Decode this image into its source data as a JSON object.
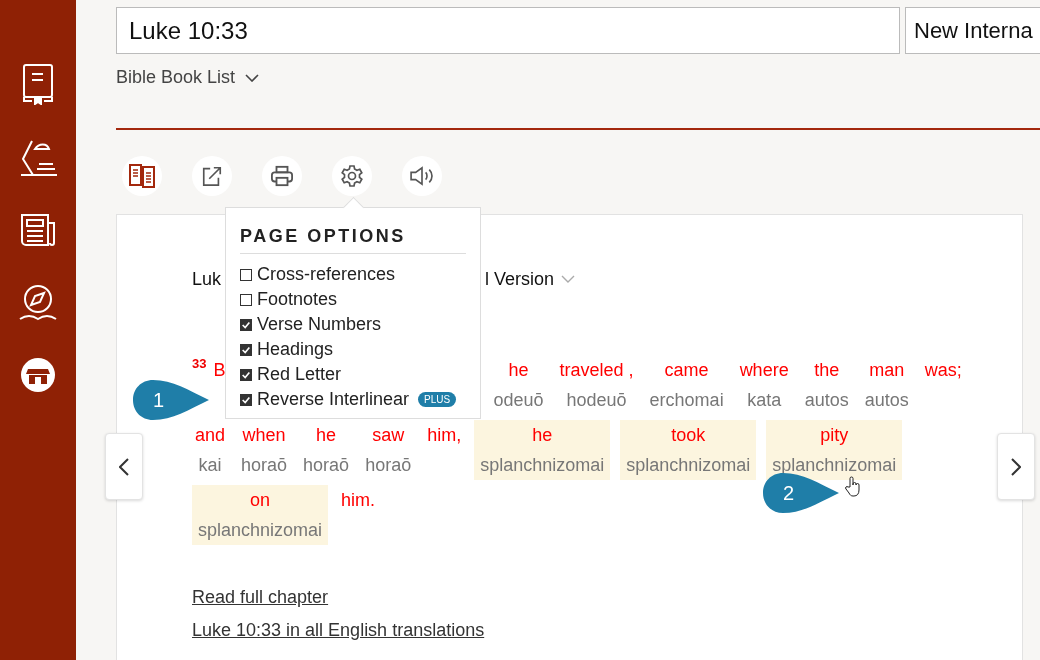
{
  "search": {
    "value": "Luke 10:33"
  },
  "version_field": {
    "value": "New Interna"
  },
  "book_list": {
    "label": "Bible Book List"
  },
  "toolbar": [
    {
      "kind": "parallel"
    },
    {
      "kind": "share"
    },
    {
      "kind": "print"
    },
    {
      "kind": "settings"
    },
    {
      "kind": "audio"
    }
  ],
  "passage": {
    "heading_start": "Luk",
    "heading_end": "l Version",
    "verse_number": "33",
    "lines": [
      {
        "lead": [
          {
            "english": "B",
            "highlighted": false
          }
        ],
        "words": [
          {
            "english": "he",
            "greek": "odeuō",
            "highlighted": false
          },
          {
            "english": "traveled ,",
            "greek": "hodeuō",
            "highlighted": false
          },
          {
            "english": "came",
            "greek": "erchomai",
            "highlighted": false
          },
          {
            "english": "where",
            "greek": "kata",
            "highlighted": false
          },
          {
            "english": "the",
            "greek": "autos",
            "highlighted": false
          },
          {
            "english": "man",
            "greek": "autos",
            "highlighted": false
          },
          {
            "english": "was;",
            "highlighted": false
          }
        ]
      },
      {
        "words": [
          {
            "english": "and",
            "greek": "kai",
            "highlighted": false
          },
          {
            "english": "when",
            "greek": "horaō",
            "highlighted": false
          },
          {
            "english": "he",
            "greek": "horaō",
            "highlighted": false
          },
          {
            "english": "saw",
            "greek": "horaō",
            "highlighted": false
          },
          {
            "english": "him,",
            "highlighted": false
          },
          {
            "english": "he",
            "greek": "splanchnizomai",
            "highlighted": true
          },
          {
            "english": "took",
            "greek": "splanchnizomai",
            "highlighted": true
          },
          {
            "english": "pity",
            "greek": "splanchnizomai",
            "highlighted": true
          }
        ]
      },
      {
        "words": [
          {
            "english": "on",
            "greek": "splanchnizomai",
            "highlighted": true
          },
          {
            "english": "him.",
            "highlighted": false
          }
        ]
      }
    ],
    "links": [
      "Read full chapter",
      "Luke 10:33 in all English translations"
    ]
  },
  "page_options": {
    "title": "PAGE OPTIONS",
    "items": [
      {
        "label": "Cross-references",
        "checked": false
      },
      {
        "label": "Footnotes",
        "checked": false
      },
      {
        "label": "Verse Numbers",
        "checked": true
      },
      {
        "label": "Headings",
        "checked": true
      },
      {
        "label": "Red Letter",
        "checked": true
      },
      {
        "label": "Reverse Interlinear",
        "checked": true,
        "badge": "PLUS"
      }
    ]
  },
  "callouts": [
    "1",
    "2"
  ]
}
